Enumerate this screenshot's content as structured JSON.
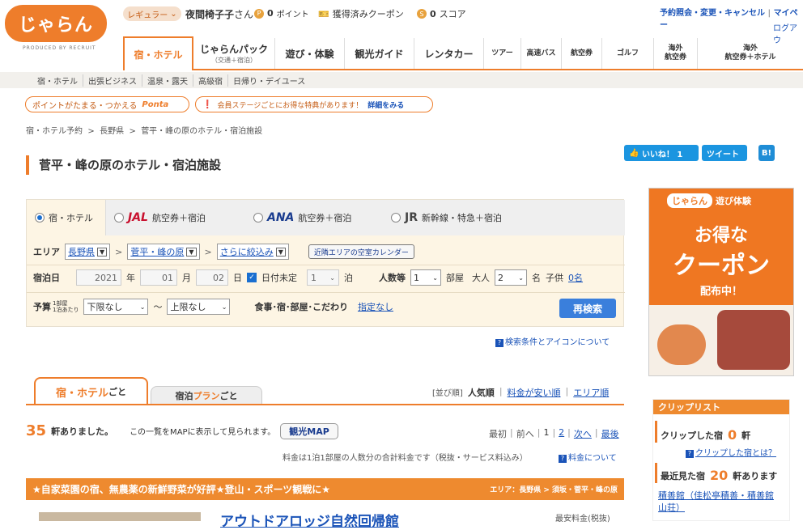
{
  "header": {
    "logo": "じゃらん",
    "logo_sub": "PRODUCED BY RECRUIT",
    "rank_label": "レギュラー",
    "user_name": "夜間椅子子",
    "user_suffix": "さん",
    "points_value": "0",
    "points_label": "ポイント",
    "coupons_label": "獲得済みクーポン",
    "score_value": "0",
    "score_label": "スコア",
    "links": [
      "予約照会・変更・キャンセル",
      "マイペー",
      "ログアウ"
    ]
  },
  "gnav": [
    {
      "label": "宿・ホテル",
      "sub": ""
    },
    {
      "label": "じゃらんパック",
      "sub": "（交通＋宿泊）"
    },
    {
      "label": "遊び・体験",
      "sub": ""
    },
    {
      "label": "観光ガイド",
      "sub": ""
    },
    {
      "label": "レンタカー",
      "sub": ""
    },
    {
      "label": "ツアー",
      "sub": ""
    },
    {
      "label": "高速バス",
      "sub": ""
    },
    {
      "label": "航空券",
      "sub": ""
    },
    {
      "label": "ゴルフ",
      "sub": ""
    },
    {
      "label": "海外",
      "sub": "航空券"
    },
    {
      "label": "海外",
      "sub": "航空券＋ホテル"
    }
  ],
  "subnav": [
    "宿・ホテル",
    "出張ビジネス",
    "温泉・露天",
    "高級宿",
    "日帰り・デイユース"
  ],
  "promo": {
    "ponta_text": "ポイントがたまる・つかえる",
    "ponta_brand": "Ponta",
    "member_text": "会員ステージごとにお得な特典があります！",
    "member_link": "詳細をみる"
  },
  "breadcrumb": [
    "宿・ホテル予約",
    "長野県",
    "菅平・峰の原のホテル・宿泊施設"
  ],
  "page_title": "菅平・峰の原のホテル・宿泊施設",
  "social": {
    "like": "いいね！ 1",
    "tweet": "ツイート",
    "hatena": "B!"
  },
  "search": {
    "tabs": [
      {
        "brand": "",
        "label": "宿・ホテル"
      },
      {
        "brand": "JAL",
        "label": "航空券＋宿泊"
      },
      {
        "brand": "ANA",
        "label": "航空券＋宿泊"
      },
      {
        "brand": "JR",
        "label": "新幹線・特急＋宿泊"
      }
    ],
    "area_label": "エリア",
    "area_pref": "長野県",
    "area_city": "菅平・峰の原",
    "area_more": "さらに絞込み",
    "calendar_btn": "近隣エリアの空室カレンダー",
    "date_label": "宿泊日",
    "year": "2021",
    "year_unit": "年",
    "month": "01",
    "month_unit": "月",
    "day": "02",
    "day_unit": "日",
    "undecided": "日付未定",
    "nights": "1",
    "nights_unit": "泊",
    "people_label": "人数等",
    "rooms": "1",
    "rooms_unit": "部屋",
    "adult_label": "大人",
    "adults": "2",
    "adult_unit": "名",
    "child_label": "子供",
    "children": "0名",
    "budget_label": "予算",
    "budget_sub1": "1部屋",
    "budget_sub2": "1泊あたり",
    "min_price": "下限なし",
    "tilde": "〜",
    "max_price": "上限なし",
    "cond_label": "食事･宿･部屋･こだわり",
    "cond_value": "指定なし",
    "research_btn": "再検索",
    "help_link": "検索条件とアイコンについて"
  },
  "results": {
    "tab_hotel_a": "宿・ホテル",
    "tab_hotel_b": "ごと",
    "tab_plan_a": "宿泊",
    "tab_plan_b": "プラン",
    "tab_plan_c": "ごと",
    "sort_label": "[並び順]",
    "sort_options": [
      "人気順",
      "料金が安い順",
      "エリア順"
    ],
    "count": "35",
    "count_unit": "軒ありました。",
    "map_text": "この一覧をMAPに表示して見られます。",
    "map_btn": "観光MAP",
    "pager": [
      "最初",
      "前へ",
      "1",
      "2",
      "次へ",
      "最後"
    ],
    "price_note": "料金は1泊1部屋の人数分の合計料金です（税抜・サービス料込み）",
    "price_help": "料金について",
    "banner_title": "★自家菜園の宿、無農薬の新鮮野菜が好評★登山・スポーツ観戦に★",
    "banner_area": "エリア：長野県 > 須坂・菅平・峰の原",
    "first_hotel": "アウトドアロッジ自然回帰館",
    "first_price_label": "最安料金(税抜)"
  },
  "ad": {
    "logo": "じゃらん",
    "category": "遊び体験",
    "line1": "お得な",
    "line2": "クーポン",
    "line3": "配布中！"
  },
  "clip": {
    "header": "クリップリスト",
    "clipped_label": "クリップした宿",
    "clipped_count": "0",
    "clipped_unit": "軒",
    "clip_help": "クリップした宿とは？",
    "recent_label": "最近見た宿",
    "recent_count": "20",
    "recent_unit": "軒あります",
    "recent_item": "積善館（佳松亭積善・積善館山荘）"
  }
}
